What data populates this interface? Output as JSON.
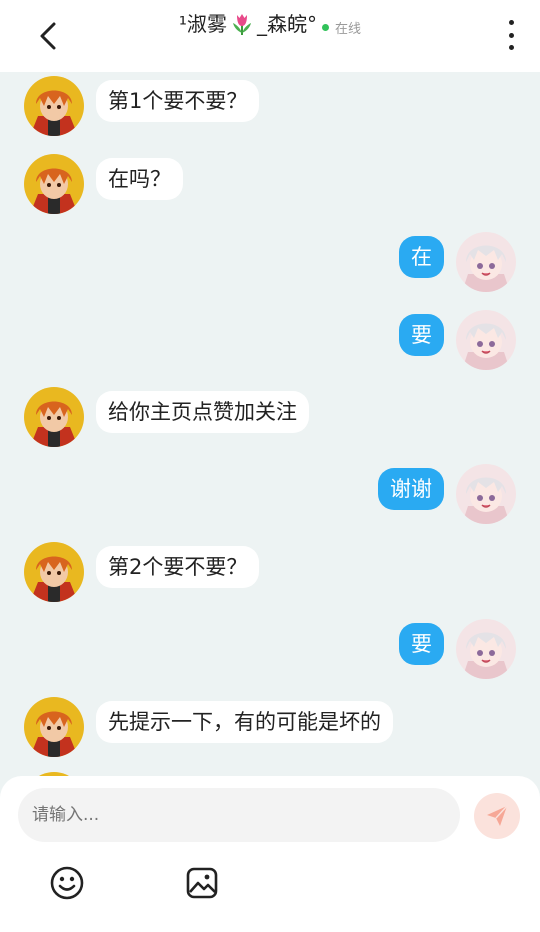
{
  "header": {
    "title_prefix": "¹淑雾",
    "title_suffix": "_森皖°",
    "status": "在线"
  },
  "composer": {
    "placeholder": "请输入..."
  },
  "messages": [
    {
      "side": "left",
      "text": "第1个要不要？"
    },
    {
      "side": "left",
      "text": "在吗？"
    },
    {
      "side": "right",
      "text": "在"
    },
    {
      "side": "right",
      "text": "要"
    },
    {
      "side": "left",
      "text": "给你主页点赞加关注"
    },
    {
      "side": "right",
      "text": "谢谢"
    },
    {
      "side": "left",
      "text": "第2个要不要？"
    },
    {
      "side": "right",
      "text": "要"
    },
    {
      "side": "left",
      "text": "先提示一下，有的可能是坏的"
    }
  ],
  "colors": {
    "accent": "#2aaaf2",
    "background": "#edf3f3",
    "online": "#32c25a"
  }
}
